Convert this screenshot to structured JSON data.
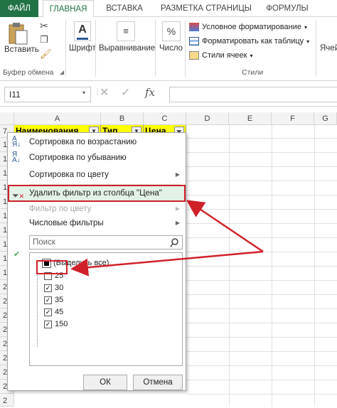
{
  "tabs": [
    {
      "label": "ФАЙЛ"
    },
    {
      "label": "ГЛАВНАЯ"
    },
    {
      "label": "ВСТАВКА"
    },
    {
      "label": "РАЗМЕТКА СТРАНИЦЫ"
    },
    {
      "label": "ФОРМУЛЫ"
    }
  ],
  "ribbon": {
    "paste_label": "Вставить",
    "clipboard_group": "Буфер обмена",
    "font_label": "Шрифт",
    "align_label": "Выравнивание",
    "number_label": "Число",
    "conditional_fmt": "Условное форматирование",
    "format_table": "Форматировать как таблицу",
    "cell_styles": "Стили ячеек",
    "styles_group": "Стили",
    "cells_label": "Ячей"
  },
  "formula_bar": {
    "name_box": "I11",
    "fx": "fx"
  },
  "grid": {
    "columns": [
      "A",
      "B",
      "C",
      "D",
      "E",
      "F",
      "G"
    ],
    "header_row_num": "7",
    "headers": [
      "Наименования",
      "Тип",
      "Цена"
    ],
    "row_nums": [
      "1",
      "1",
      "1",
      "1",
      "1",
      "1",
      "1",
      "1",
      "1",
      "1",
      "2",
      "2",
      "2",
      "2",
      "2",
      "2",
      "2",
      "2",
      "2"
    ]
  },
  "menu": {
    "sort_asc": "Сортировка по возрастанию",
    "sort_desc": "Сортировка по убыванию",
    "sort_color": "Сортировка по цвету",
    "clear_filter": "Удалить фильтр из столбца \"Цена\"",
    "filter_color": "Фильтр по цвету",
    "number_filters": "Числовые фильтры",
    "search_placeholder": "Поиск",
    "select_all": "(Выделить все)",
    "items": [
      {
        "label": "25",
        "checked": false
      },
      {
        "label": "30",
        "checked": true
      },
      {
        "label": "35",
        "checked": true
      },
      {
        "label": "45",
        "checked": true
      },
      {
        "label": "150",
        "checked": true
      }
    ],
    "ok": "ОК",
    "cancel": "Отмена"
  },
  "colors": {
    "excel_green": "#217346",
    "header_fill": "#ffff00",
    "annotation_red": "#d0202a",
    "highlight_fill": "#e3f1e6"
  }
}
